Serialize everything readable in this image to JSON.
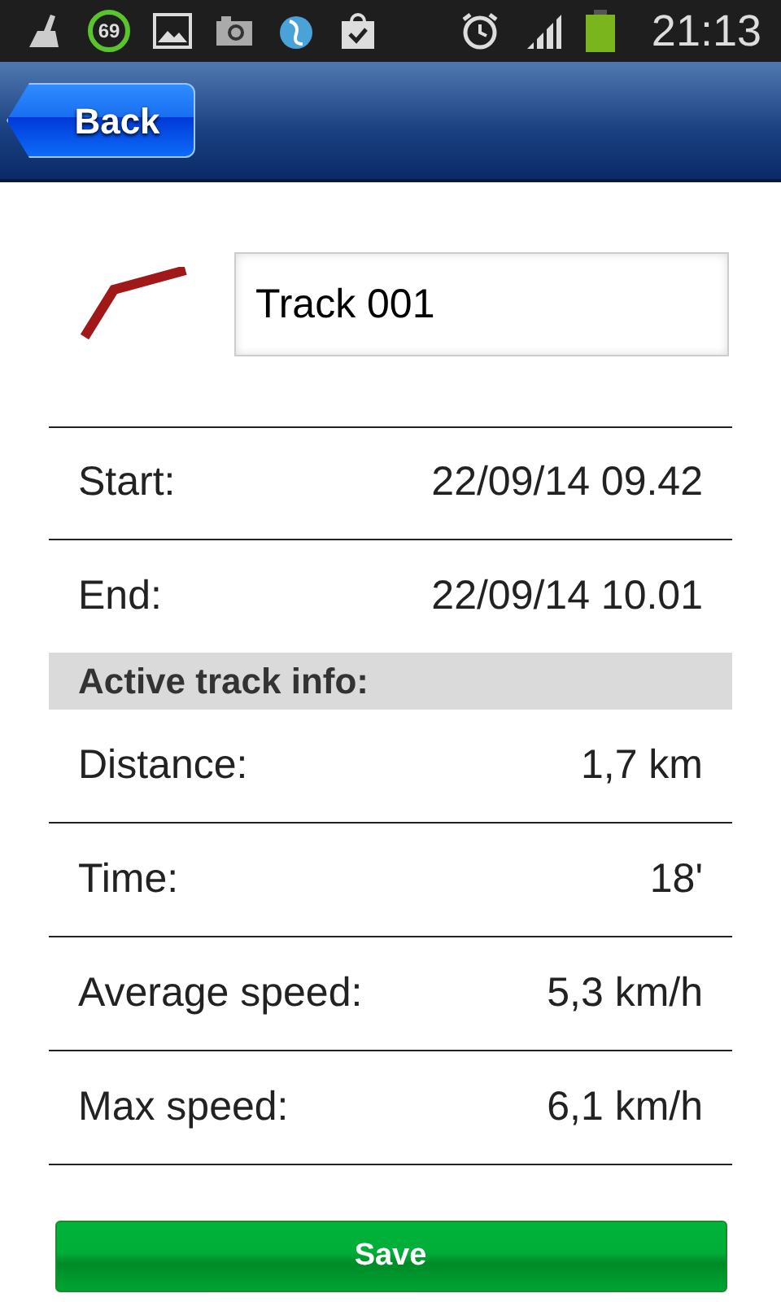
{
  "status_bar": {
    "badge": "69",
    "time": "21:13"
  },
  "header": {
    "back_button": "Back"
  },
  "track": {
    "name": "Track 001"
  },
  "times": [
    {
      "label": "Start:",
      "value": "22/09/14 09.42"
    },
    {
      "label": "End:",
      "value": "22/09/14 10.01"
    }
  ],
  "section_title": "Active track info:",
  "stats": [
    {
      "label": "Distance:",
      "value": "1,7 km"
    },
    {
      "label": "Time:",
      "value": "18'"
    },
    {
      "label": "Average speed:",
      "value": "5,3 km/h"
    },
    {
      "label": "Max speed:",
      "value": "6,1 km/h"
    }
  ],
  "save_button": "Save"
}
